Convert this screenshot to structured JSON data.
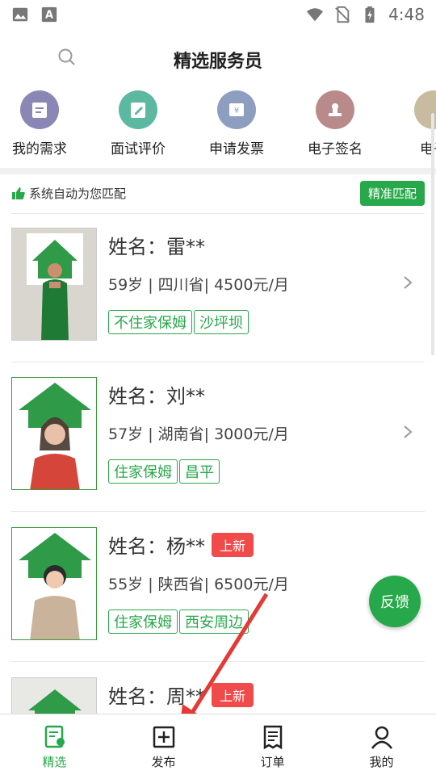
{
  "status_bar": {
    "time": "4:48"
  },
  "header": {
    "title": "精选服务员"
  },
  "services": [
    {
      "label": "我的需求",
      "icon": "calendar-icon",
      "color": "#8a86b5"
    },
    {
      "label": "面试评价",
      "icon": "edit-icon",
      "color": "#5cb8a0"
    },
    {
      "label": "申请发票",
      "icon": "invoice-icon",
      "color": "#8e9ec0"
    },
    {
      "label": "电子签名",
      "icon": "stamp-icon",
      "color": "#b88a8a"
    },
    {
      "label": "电子",
      "icon": "more-icon",
      "color": "#c8bca0"
    }
  ],
  "match_bar": {
    "text": "系统自动为您匹配",
    "button": "精准匹配"
  },
  "workers": [
    {
      "name": "姓名：雷**",
      "info": "59岁 | 四川省| 4500元/月",
      "tags": [
        "不住家保姆",
        "沙坪坝"
      ],
      "badge": ""
    },
    {
      "name": "姓名：刘**",
      "info": "57岁 | 湖南省| 3000元/月",
      "tags": [
        "住家保姆",
        "昌平"
      ],
      "badge": ""
    },
    {
      "name": "姓名：杨**",
      "info": "55岁 | 陕西省| 6500元/月",
      "tags": [
        "住家保姆",
        "西安周边"
      ],
      "badge": "上新"
    },
    {
      "name": "姓名：周**",
      "info": "",
      "tags": [],
      "badge": "上新"
    }
  ],
  "feedback_button": "反馈",
  "tabbar": [
    {
      "label": "精选",
      "active": true
    },
    {
      "label": "发布",
      "active": false
    },
    {
      "label": "订单",
      "active": false
    },
    {
      "label": "我的",
      "active": false
    }
  ],
  "colors": {
    "accent": "#27a84a",
    "badge": "#f04a4a",
    "annotation_arrow": "#e53935"
  }
}
